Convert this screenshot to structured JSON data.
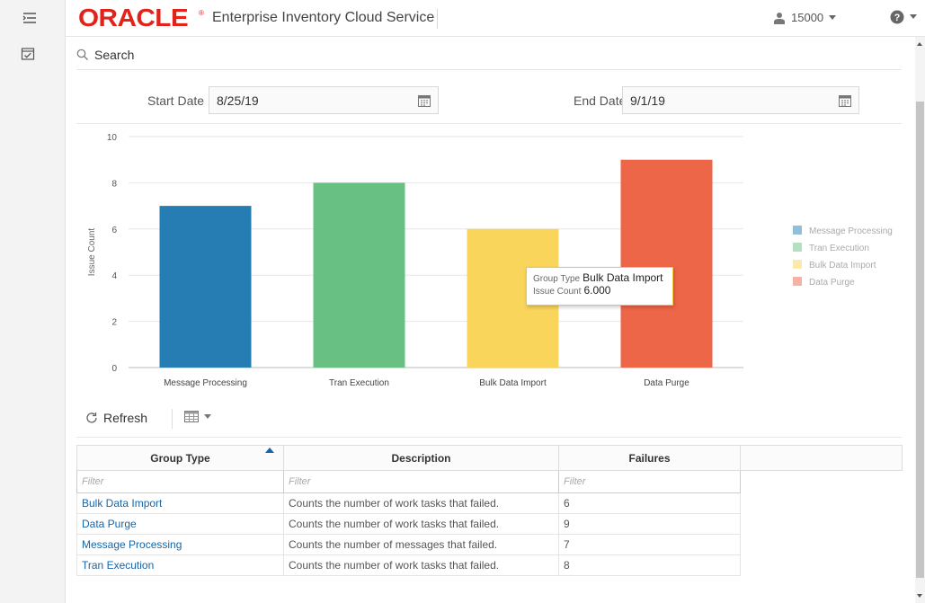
{
  "header": {
    "logo_text": "ORACLE",
    "logo_mark": "®",
    "app_title": "Enterprise Inventory Cloud Service",
    "store_id": "15000"
  },
  "search": {
    "label": "Search"
  },
  "filters": {
    "start_label": "Start Date",
    "start_value": "8/25/19",
    "end_label": "End Date",
    "end_value": "9/1/19"
  },
  "chart_data": {
    "type": "bar",
    "categories": [
      "Message Processing",
      "Tran Execution",
      "Bulk Data Import",
      "Data Purge"
    ],
    "values": [
      7,
      8,
      6,
      9
    ],
    "colors": [
      "#267db3",
      "#68c182",
      "#fad55c",
      "#ed6647"
    ],
    "ylabel": "Issue Count",
    "xlabel": "",
    "ylim": [
      0,
      10
    ],
    "yticks": [
      0,
      2,
      4,
      6,
      8,
      10
    ],
    "grid": true,
    "legend": {
      "placement": "right",
      "entries": [
        "Message Processing",
        "Tran Execution",
        "Bulk Data Import",
        "Data Purge"
      ]
    }
  },
  "tooltip": {
    "group_label": "Group Type",
    "group_value": "Bulk Data Import",
    "count_label": "Issue Count",
    "count_value": "6.000"
  },
  "toolbar": {
    "refresh_label": "Refresh"
  },
  "table": {
    "headers": [
      "Group Type",
      "Description",
      "Failures"
    ],
    "filter_placeholder": "Filter",
    "rows": [
      {
        "group": "Bulk Data Import",
        "description": "Counts the number of work tasks that failed.",
        "failures": "6"
      },
      {
        "group": "Data Purge",
        "description": "Counts the number of work tasks that failed.",
        "failures": "9"
      },
      {
        "group": "Message Processing",
        "description": "Counts the number of messages that failed.",
        "failures": "7"
      },
      {
        "group": "Tran Execution",
        "description": "Counts the number of work tasks that failed.",
        "failures": "8"
      }
    ]
  },
  "icons": {
    "menu": "menu-icon",
    "task": "task-list-icon",
    "user": "user-icon",
    "help": "help-icon",
    "search": "search-icon",
    "calendar": "calendar-icon",
    "refresh": "refresh-icon",
    "grid": "grid-view-icon"
  }
}
